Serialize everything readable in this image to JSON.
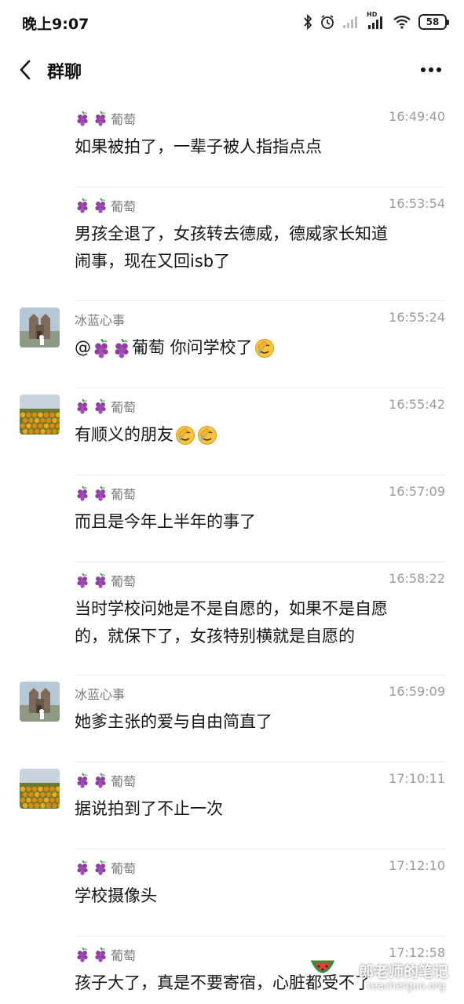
{
  "status_bar": {
    "time": "晚上9:07",
    "battery": "58",
    "network_label": "HD"
  },
  "nav": {
    "title": "群聊"
  },
  "messages": [
    {
      "sender": "葡萄",
      "sender_prefix_icons": [
        "grape-icon",
        "grape-icon"
      ],
      "time": "16:49:40",
      "lines": [
        "如果被拍了，一辈子被人指指点点"
      ],
      "avatar": "none"
    },
    {
      "sender": "葡萄",
      "sender_prefix_icons": [
        "grape-icon",
        "grape-icon"
      ],
      "time": "16:53:54",
      "lines": [
        "男孩全退了，女孩转去德威，德威家长知道",
        "闹事，现在又回isb了"
      ],
      "avatar": "none"
    },
    {
      "sender": "冰蓝心事",
      "time": "16:55:24",
      "text_prefix": "@",
      "text_mention": "葡萄",
      "text_suffix": " 你问学校了",
      "lines": [],
      "avatar": "building-photo",
      "emoji": "facepalm-emoji"
    },
    {
      "sender": "葡萄",
      "sender_prefix_icons": [
        "grape-icon",
        "grape-icon"
      ],
      "time": "16:55:42",
      "lines": [
        "有顺义的朋友"
      ],
      "avatar": "flower-field-photo",
      "emoji_count": 2
    },
    {
      "sender": "葡萄",
      "sender_prefix_icons": [
        "grape-icon",
        "grape-icon"
      ],
      "time": "16:57:09",
      "lines": [
        "而且是今年上半年的事了"
      ],
      "avatar": "none"
    },
    {
      "sender": "葡萄",
      "sender_prefix_icons": [
        "grape-icon",
        "grape-icon"
      ],
      "time": "16:58:22",
      "lines": [
        "当时学校问她是不是自愿的，如果不是自愿",
        "的，就保下了，女孩特别横就是自愿的"
      ],
      "avatar": "none"
    },
    {
      "sender": "冰蓝心事",
      "time": "16:59:09",
      "lines": [
        "她爹主张的爱与自由简直了"
      ],
      "avatar": "building-photo"
    },
    {
      "sender": "葡萄",
      "sender_prefix_icons": [
        "grape-icon",
        "grape-icon"
      ],
      "time": "17:10:11",
      "lines": [
        "据说拍到了不止一次"
      ],
      "avatar": "flower-field-photo"
    },
    {
      "sender": "葡萄",
      "sender_prefix_icons": [
        "grape-icon",
        "grape-icon"
      ],
      "time": "17:12:10",
      "lines": [
        "学校摄像头"
      ],
      "avatar": "none"
    },
    {
      "sender": "葡萄",
      "sender_prefix_icons": [
        "grape-icon",
        "grape-icon"
      ],
      "time": "17:12:58",
      "lines": [
        "孩子大了，真是不要寄宿，心脏都受不了"
      ],
      "avatar": "none"
    }
  ],
  "watermark": {
    "line1": "郎老师的笔记",
    "line2": "teacherguo.org"
  },
  "colors": {
    "background": "#ffffff",
    "sender_text": "#7a7a7a",
    "time_text": "#9a9a9a",
    "body_text": "#151515",
    "divider": "#ececec"
  }
}
